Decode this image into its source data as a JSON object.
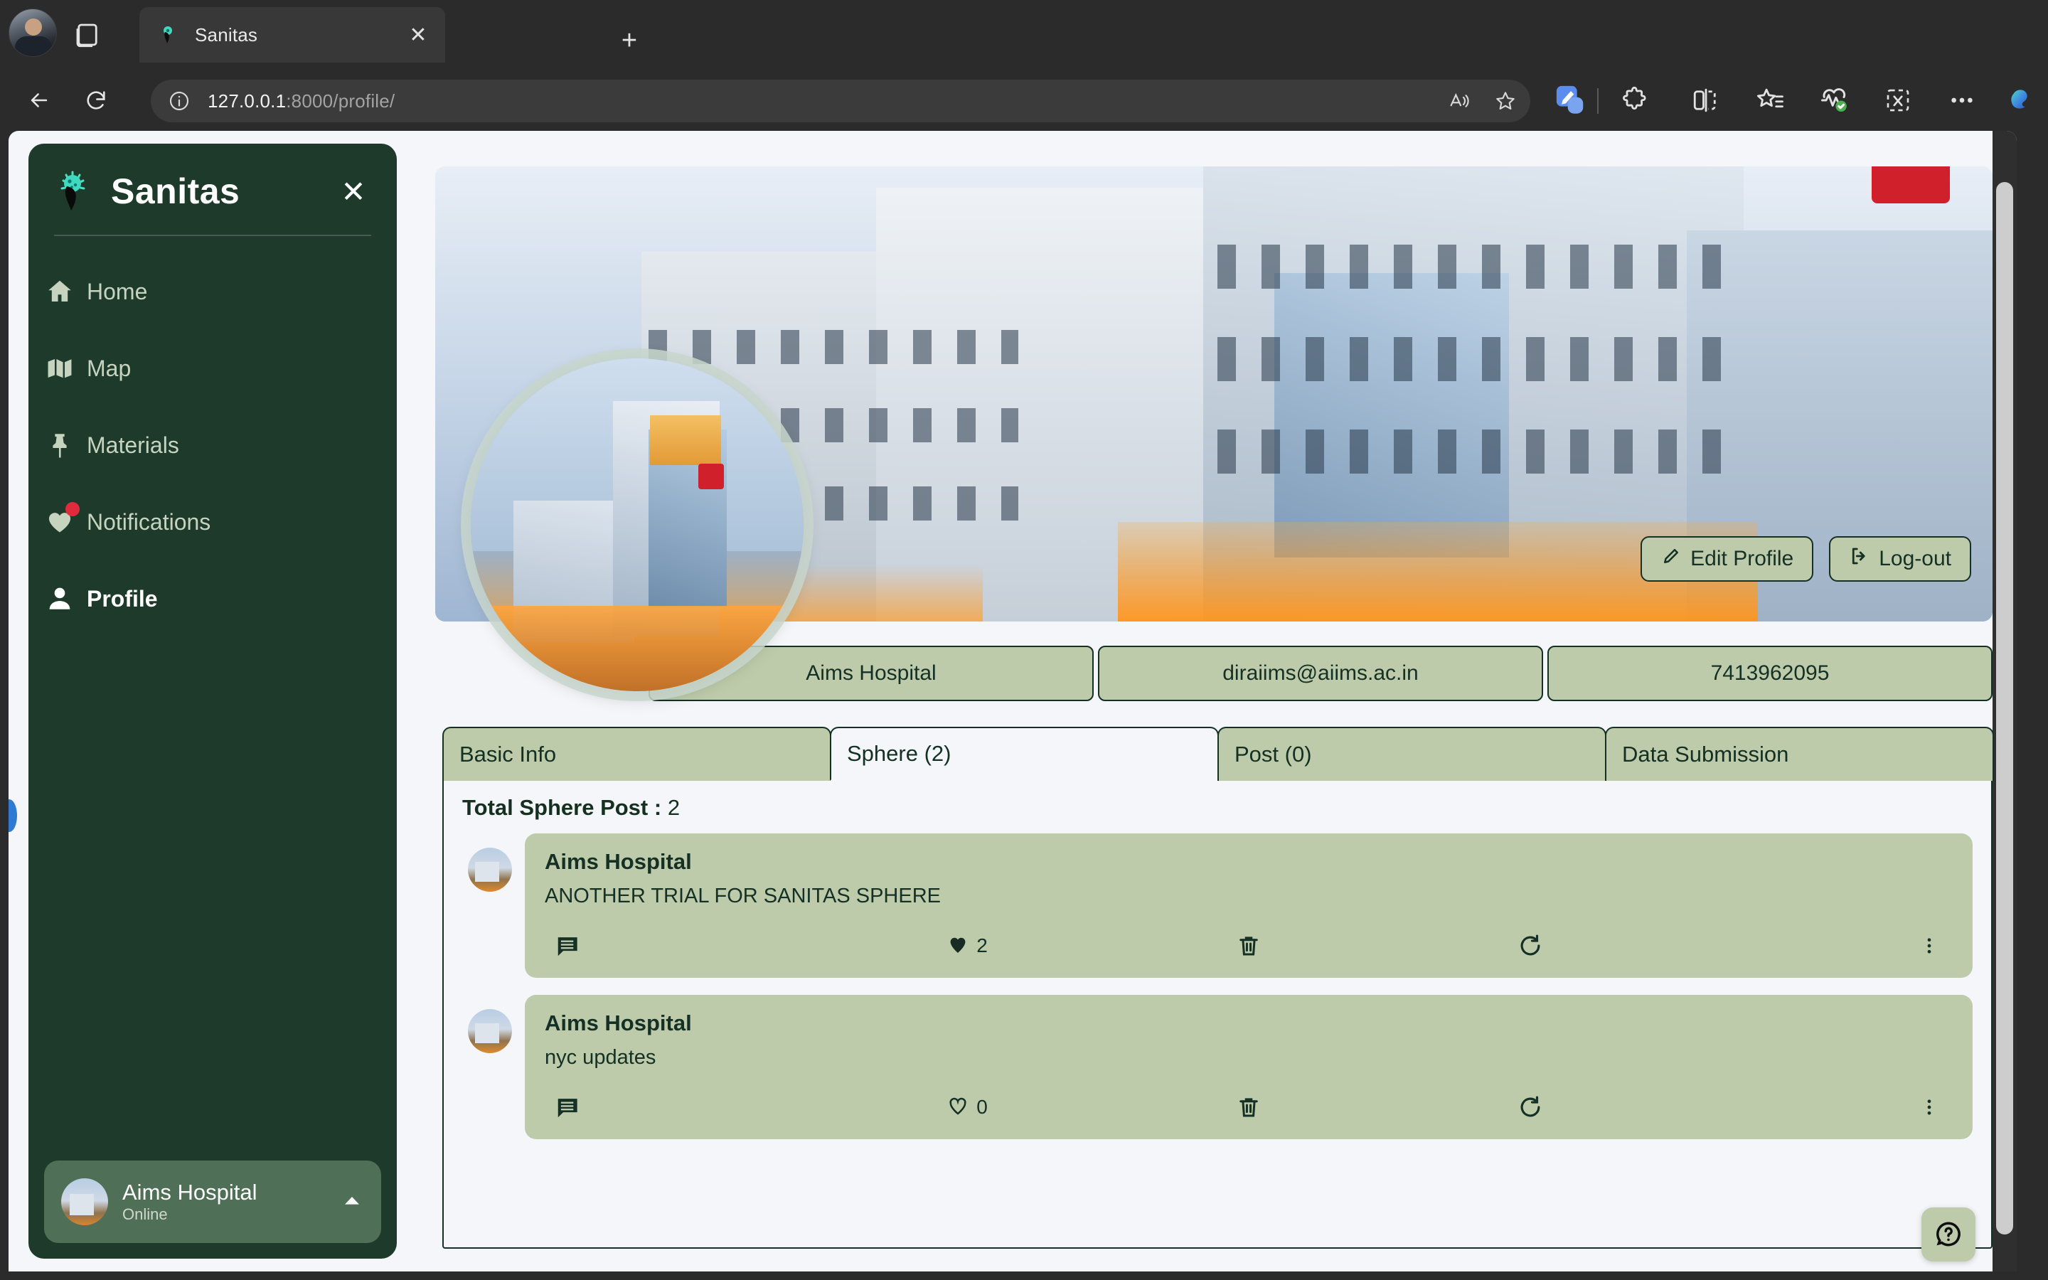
{
  "browser": {
    "profile_avatar": "user-avatar",
    "workspaces_label": "workspaces-icon",
    "tab": {
      "title": "Sanitas",
      "favicon": "sanitas-logo-icon",
      "close_label": "✕"
    },
    "new_tab_label": "+",
    "back_label": "back-icon",
    "reload_label": "reload-icon",
    "url": {
      "host": "127.0.0.1",
      "path": ":8000/profile/",
      "info_icon": "site-info-icon"
    },
    "omnibox_actions": [
      {
        "name": "read-aloud-icon"
      },
      {
        "name": "favorite-star-icon"
      }
    ],
    "toolbar": [
      {
        "name": "collections-pen-icon"
      },
      {
        "name": "extensions-puzzle-icon"
      },
      {
        "name": "split-screen-icon"
      },
      {
        "name": "favorites-star-list-icon"
      },
      {
        "name": "browser-essentials-icon"
      },
      {
        "name": "screenshot-capture-icon"
      },
      {
        "name": "settings-more-icon"
      },
      {
        "name": "copilot-icon"
      }
    ]
  },
  "sidebar": {
    "brand": "Sanitas",
    "logo_name": "sanitas-virus-logo",
    "close_label": "✕",
    "items": [
      {
        "label": "Home",
        "icon": "home-icon",
        "active": false,
        "badge": false
      },
      {
        "label": "Map",
        "icon": "map-icon",
        "active": false,
        "badge": false
      },
      {
        "label": "Materials",
        "icon": "pin-icon",
        "active": false,
        "badge": false
      },
      {
        "label": "Notifications",
        "icon": "heart-icon",
        "active": false,
        "badge": true
      },
      {
        "label": "Profile",
        "icon": "person-icon",
        "active": true,
        "badge": false
      }
    ],
    "user": {
      "name": "Aims Hospital",
      "status": "Online",
      "avatar": "hospital-avatar",
      "caret": "chevron-up-icon"
    }
  },
  "profile": {
    "cover_image_alt": "hospital-cover-photo",
    "avatar_alt": "hospital-profile-photo",
    "edit_button": "Edit Profile",
    "edit_icon": "pencil-icon",
    "logout_button": "Log-out",
    "logout_icon": "logout-icon",
    "info": [
      {
        "name": "profile-name",
        "value": "Aims Hospital"
      },
      {
        "name": "profile-email",
        "value": "diraiims@aiims.ac.in"
      },
      {
        "name": "profile-phone",
        "value": "7413962095"
      }
    ],
    "tabs": [
      {
        "label": "Basic Info",
        "active": false
      },
      {
        "label": "Sphere (2)",
        "active": true
      },
      {
        "label": "Post (0)",
        "active": false
      },
      {
        "label": "Data Submission",
        "active": false
      }
    ],
    "total_label": "Total Sphere Post :",
    "total_value": "2",
    "posts": [
      {
        "author": "Aims Hospital",
        "text": "ANOTHER TRIAL FOR SANITAS SPHERE",
        "comment_icon": "comment-icon",
        "like_icon": "heart-filled-icon",
        "likes": "2",
        "liked": true,
        "delete_icon": "trash-icon",
        "refresh_icon": "refresh-icon",
        "menu_icon": "more-vertical-icon"
      },
      {
        "author": "Aims Hospital",
        "text": "nyc updates",
        "comment_icon": "comment-icon",
        "like_icon": "heart-outline-icon",
        "likes": "0",
        "liked": false,
        "delete_icon": "trash-icon",
        "refresh_icon": "refresh-icon",
        "menu_icon": "more-vertical-icon"
      }
    ]
  },
  "help": {
    "label": "?",
    "icon": "help-question-icon"
  },
  "colors": {
    "brand_dark_green": "#1d3a2b",
    "accent_sage": "#bdcbab",
    "text_dark_green": "#153024",
    "page_bg": "#f4f6f9",
    "chrome_bg": "#2b2b2b",
    "badge_red": "#e02b3c"
  }
}
